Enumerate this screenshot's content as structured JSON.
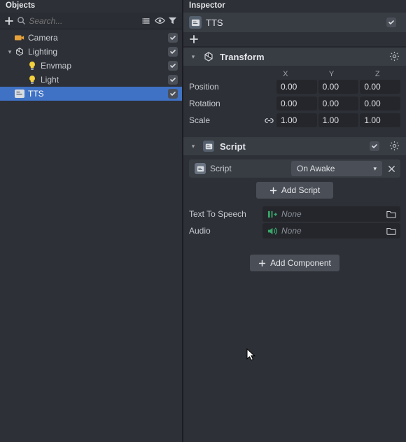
{
  "objects": {
    "panel_title": "Objects",
    "search_placeholder": "Search...",
    "tree": [
      {
        "label": "Camera",
        "depth": 0,
        "arrow": "",
        "icon": "camera",
        "checked": true,
        "selected": false
      },
      {
        "label": "Lighting",
        "depth": 0,
        "arrow": "▾",
        "icon": "lighting",
        "checked": true,
        "selected": false
      },
      {
        "label": "Envmap",
        "depth": 1,
        "arrow": "",
        "icon": "bulb",
        "checked": true,
        "selected": false
      },
      {
        "label": "Light",
        "depth": 1,
        "arrow": "",
        "icon": "bulb",
        "checked": true,
        "selected": false
      },
      {
        "label": "TTS",
        "depth": 0,
        "arrow": "",
        "icon": "script",
        "checked": true,
        "selected": true
      }
    ]
  },
  "inspector": {
    "panel_title": "Inspector",
    "object_name": "TTS",
    "components": {
      "transform": {
        "title": "Transform",
        "cols": [
          "X",
          "Y",
          "Z"
        ],
        "rows": [
          {
            "label": "Position",
            "v": [
              "0.00",
              "0.00",
              "0.00"
            ]
          },
          {
            "label": "Rotation",
            "v": [
              "0.00",
              "0.00",
              "0.00"
            ]
          },
          {
            "label": "Scale",
            "v": [
              "1.00",
              "1.00",
              "1.00"
            ],
            "link": true
          }
        ]
      },
      "script": {
        "title": "Script",
        "script_label": "Script",
        "dropdown": "On Awake",
        "add_script": "Add Script",
        "props": [
          {
            "label": "Text To Speech",
            "placeholder": "None",
            "icon": "tts"
          },
          {
            "label": "Audio",
            "placeholder": "None",
            "icon": "audio"
          }
        ]
      }
    },
    "add_component": "Add Component"
  }
}
